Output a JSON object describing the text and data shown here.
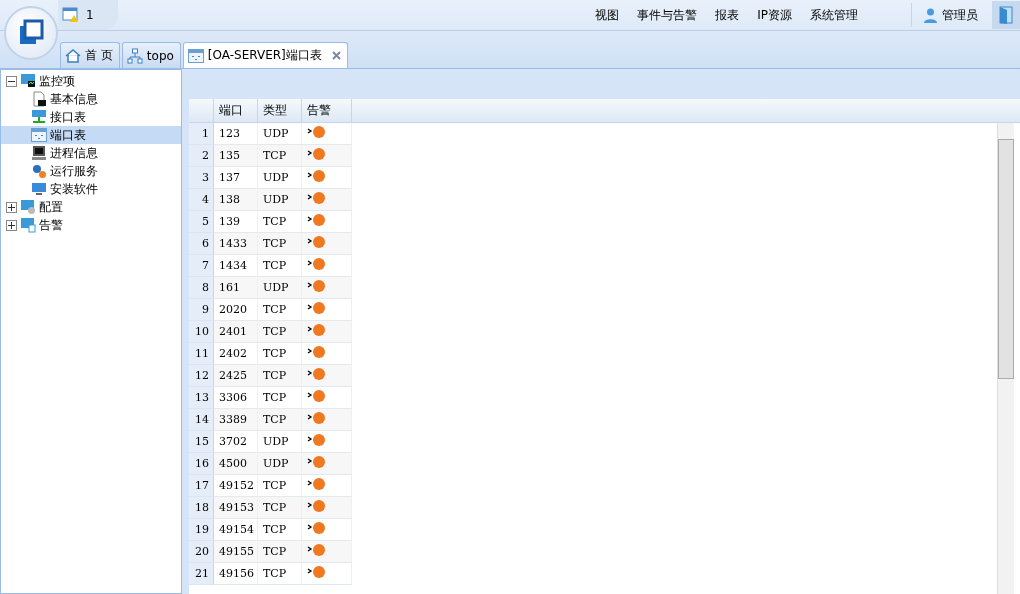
{
  "notice": {
    "count": "1"
  },
  "menu": [
    "视图",
    "事件与告警",
    "报表",
    "IP资源",
    "系统管理"
  ],
  "user": {
    "name": "管理员"
  },
  "tabs": [
    {
      "label": "首 页",
      "kind": "home",
      "selected": false,
      "closable": false
    },
    {
      "label": "topo",
      "kind": "topo",
      "selected": false,
      "closable": false
    },
    {
      "label": "[OA-SERVER]端口表",
      "kind": "grid",
      "selected": true,
      "closable": true
    }
  ],
  "tree": [
    {
      "label": "监控项",
      "kind": "monitor",
      "expanded": true,
      "selected": false,
      "children": [
        {
          "label": "基本信息",
          "kind": "doc",
          "selected": false
        },
        {
          "label": "接口表",
          "kind": "network",
          "selected": false
        },
        {
          "label": "端口表",
          "kind": "grid",
          "selected": true
        },
        {
          "label": "进程信息",
          "kind": "terminal",
          "selected": false
        },
        {
          "label": "运行服务",
          "kind": "gear",
          "selected": false
        },
        {
          "label": "安装软件",
          "kind": "screen",
          "selected": false
        }
      ]
    },
    {
      "label": "配置",
      "kind": "config",
      "expanded": false,
      "selected": false
    },
    {
      "label": "告警",
      "kind": "alarm",
      "expanded": false,
      "selected": false
    }
  ],
  "table": {
    "columns": [
      "端口",
      "类型",
      "告警"
    ],
    "rows": [
      {
        "index": "1",
        "port": "123",
        "type": "UDP"
      },
      {
        "index": "2",
        "port": "135",
        "type": "TCP"
      },
      {
        "index": "3",
        "port": "137",
        "type": "UDP"
      },
      {
        "index": "4",
        "port": "138",
        "type": "UDP"
      },
      {
        "index": "5",
        "port": "139",
        "type": "TCP"
      },
      {
        "index": "6",
        "port": "1433",
        "type": "TCP"
      },
      {
        "index": "7",
        "port": "1434",
        "type": "TCP"
      },
      {
        "index": "8",
        "port": "161",
        "type": "UDP"
      },
      {
        "index": "9",
        "port": "2020",
        "type": "TCP"
      },
      {
        "index": "10",
        "port": "2401",
        "type": "TCP"
      },
      {
        "index": "11",
        "port": "2402",
        "type": "TCP"
      },
      {
        "index": "12",
        "port": "2425",
        "type": "TCP"
      },
      {
        "index": "13",
        "port": "3306",
        "type": "TCP"
      },
      {
        "index": "14",
        "port": "3389",
        "type": "TCP"
      },
      {
        "index": "15",
        "port": "3702",
        "type": "UDP"
      },
      {
        "index": "16",
        "port": "4500",
        "type": "UDP"
      },
      {
        "index": "17",
        "port": "49152",
        "type": "TCP"
      },
      {
        "index": "18",
        "port": "49153",
        "type": "TCP"
      },
      {
        "index": "19",
        "port": "49154",
        "type": "TCP"
      },
      {
        "index": "20",
        "port": "49155",
        "type": "TCP"
      },
      {
        "index": "21",
        "port": "49156",
        "type": "TCP"
      }
    ]
  }
}
